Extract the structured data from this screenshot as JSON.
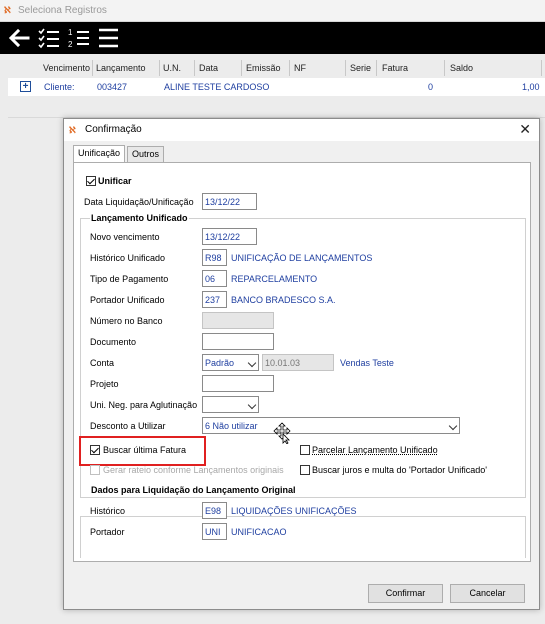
{
  "window": {
    "title": "Seleciona Registros"
  },
  "grid": {
    "columns": [
      "Vencimento",
      "Lançamento",
      "U.N.",
      "Data",
      "Emissão",
      "NF",
      "Serie",
      "Fatura",
      "Saldo"
    ],
    "row": {
      "expand_label": "+",
      "client_label": "Cliente:",
      "code": "003427",
      "name": "ALINE TESTE CARDOSO",
      "fatura": "0",
      "saldo": "1,00"
    }
  },
  "dialog": {
    "title": "Confirmação",
    "close_label": "✕",
    "tabs": [
      "Unificação",
      "Outros"
    ],
    "unificar_label": "Unificar",
    "unificar_checked": true,
    "data_liquidacao_label": "Data Liquidação/Unificação",
    "data_liquidacao_value": "13/12/22",
    "group_unificado_title": "Lançamento Unificado",
    "fields": {
      "novo_vencimento": {
        "label": "Novo vencimento",
        "value": "13/12/22"
      },
      "historico": {
        "label": "Histórico Unificado",
        "code": "R98",
        "desc": "UNIFICAÇÃO DE LANÇAMENTOS"
      },
      "tipo_pagamento": {
        "label": "Tipo de Pagamento",
        "code": "06",
        "desc": "REPARCELAMENTO"
      },
      "portador": {
        "label": "Portador Unificado",
        "code": "237",
        "desc": "BANCO BRADESCO S.A."
      },
      "numero_banco": {
        "label": "Número no Banco",
        "value": ""
      },
      "documento": {
        "label": "Documento",
        "value": ""
      },
      "conta": {
        "label": "Conta",
        "select": "Padrão",
        "code": "10.01.03",
        "desc": "Vendas Teste"
      },
      "projeto": {
        "label": "Projeto",
        "value": ""
      },
      "uni_neg": {
        "label": "Uni. Neg. para Aglutinação",
        "select": ""
      },
      "desconto": {
        "label": "Desconto a Utilizar",
        "select": "6 Não utilizar"
      }
    },
    "buscar_ultima_fatura_label": "Buscar última Fatura",
    "buscar_ultima_fatura_checked": true,
    "parcelar_label": "Parcelar Lançamento Unificado",
    "parcelar_checked": false,
    "gerar_rateio_label": "Gerar rateio conforme Lançamentos originais",
    "gerar_rateio_checked": false,
    "buscar_juros_label": "Buscar juros e multa do 'Portador Unificado'",
    "buscar_juros_checked": false,
    "group_original_title": "Dados para Liquidação do Lançamento Original",
    "original": {
      "historico": {
        "label": "Histórico",
        "code": "E98",
        "desc": "LIQUIDAÇÕES UNIFICAÇÕES"
      },
      "portador": {
        "label": "Portador",
        "code": "UNI",
        "desc": "UNIFICACAO"
      }
    },
    "confirm_label": "Confirmar",
    "cancel_label": "Cancelar"
  },
  "colors": {
    "highlight": "#e02020",
    "value_text": "#1f3fa0",
    "toolbar_bg": "#000000"
  },
  "icons": [
    "back-arrow-icon",
    "checklist-icon",
    "numbered-list-icon",
    "menu-icon",
    "move-cursor-icon"
  ]
}
